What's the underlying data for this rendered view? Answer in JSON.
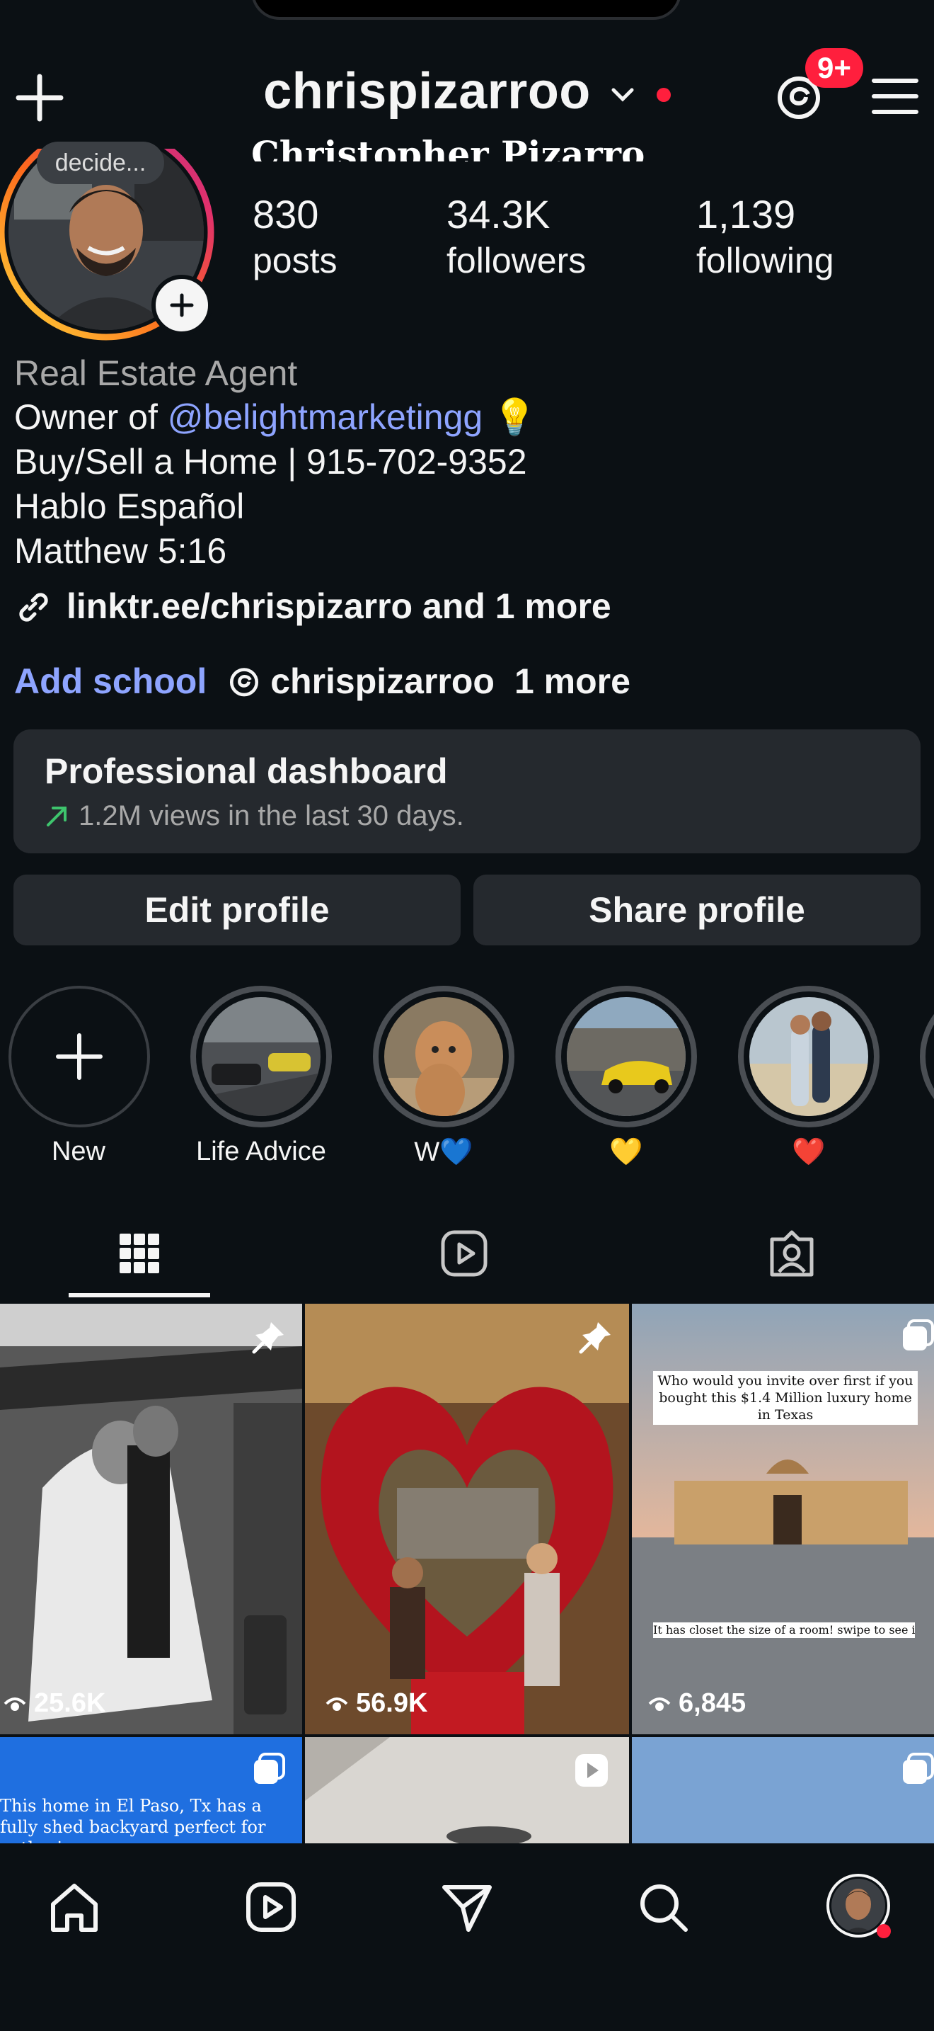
{
  "header": {
    "username": "chrispizarroo",
    "notification_badge": "9+"
  },
  "profile": {
    "display_name": "Christopher Pizarro",
    "note_bubble": "decide...",
    "stats": [
      {
        "value": "830",
        "label": "posts"
      },
      {
        "value": "34.3K",
        "label": "followers"
      },
      {
        "value": "1,139",
        "label": "following"
      }
    ],
    "category": "Real Estate Agent",
    "bio_owner_prefix": "Owner of ",
    "bio_owner_handle": "@belightmarketingg",
    "bio_owner_emoji": "💡",
    "bio_line2": "Buy/Sell a Home | 915-702-9352",
    "bio_line3": "Hablo Español",
    "bio_line4": "Matthew 5:16",
    "link_text": "linktr.ee/chrispizarro and 1 more",
    "add_school": "Add school",
    "threads_handle": "chrispizarroo",
    "threads_more": "1 more"
  },
  "dashboard": {
    "title": "Professional dashboard",
    "subtitle": "1.2M views in the last 30 days.",
    "trend_color": "#3ec46d"
  },
  "actions": {
    "edit": "Edit profile",
    "share": "Share profile"
  },
  "highlights": [
    {
      "label": "New",
      "icon": "plus-icon"
    },
    {
      "label": "Life Advice"
    },
    {
      "label": "W💙"
    },
    {
      "label": "💛"
    },
    {
      "label": "❤️"
    }
  ],
  "tabs": [
    "grid-icon",
    "reels-icon",
    "tagged-icon"
  ],
  "posts": [
    {
      "views": "25.6K",
      "pinned": true
    },
    {
      "views": "56.9K",
      "pinned": true
    },
    {
      "views": "6,845",
      "caption_top": "Who would you invite over first if you bought this $1.4 Million luxury home in Texas",
      "caption_bottom": "It has closet the size of a room! swipe to see it>>>"
    },
    {
      "caption_top": "This home in El Paso, Tx has a fully shed backyard perfect for gatherings"
    },
    {},
    {}
  ],
  "colors": {
    "background": "#0b1014",
    "card": "#25292e",
    "link": "#8ea4ff",
    "badge": "#ff1f3d"
  },
  "bottom_nav": [
    "home-icon",
    "reels-icon",
    "messages-icon",
    "search-icon",
    "profile-avatar"
  ]
}
